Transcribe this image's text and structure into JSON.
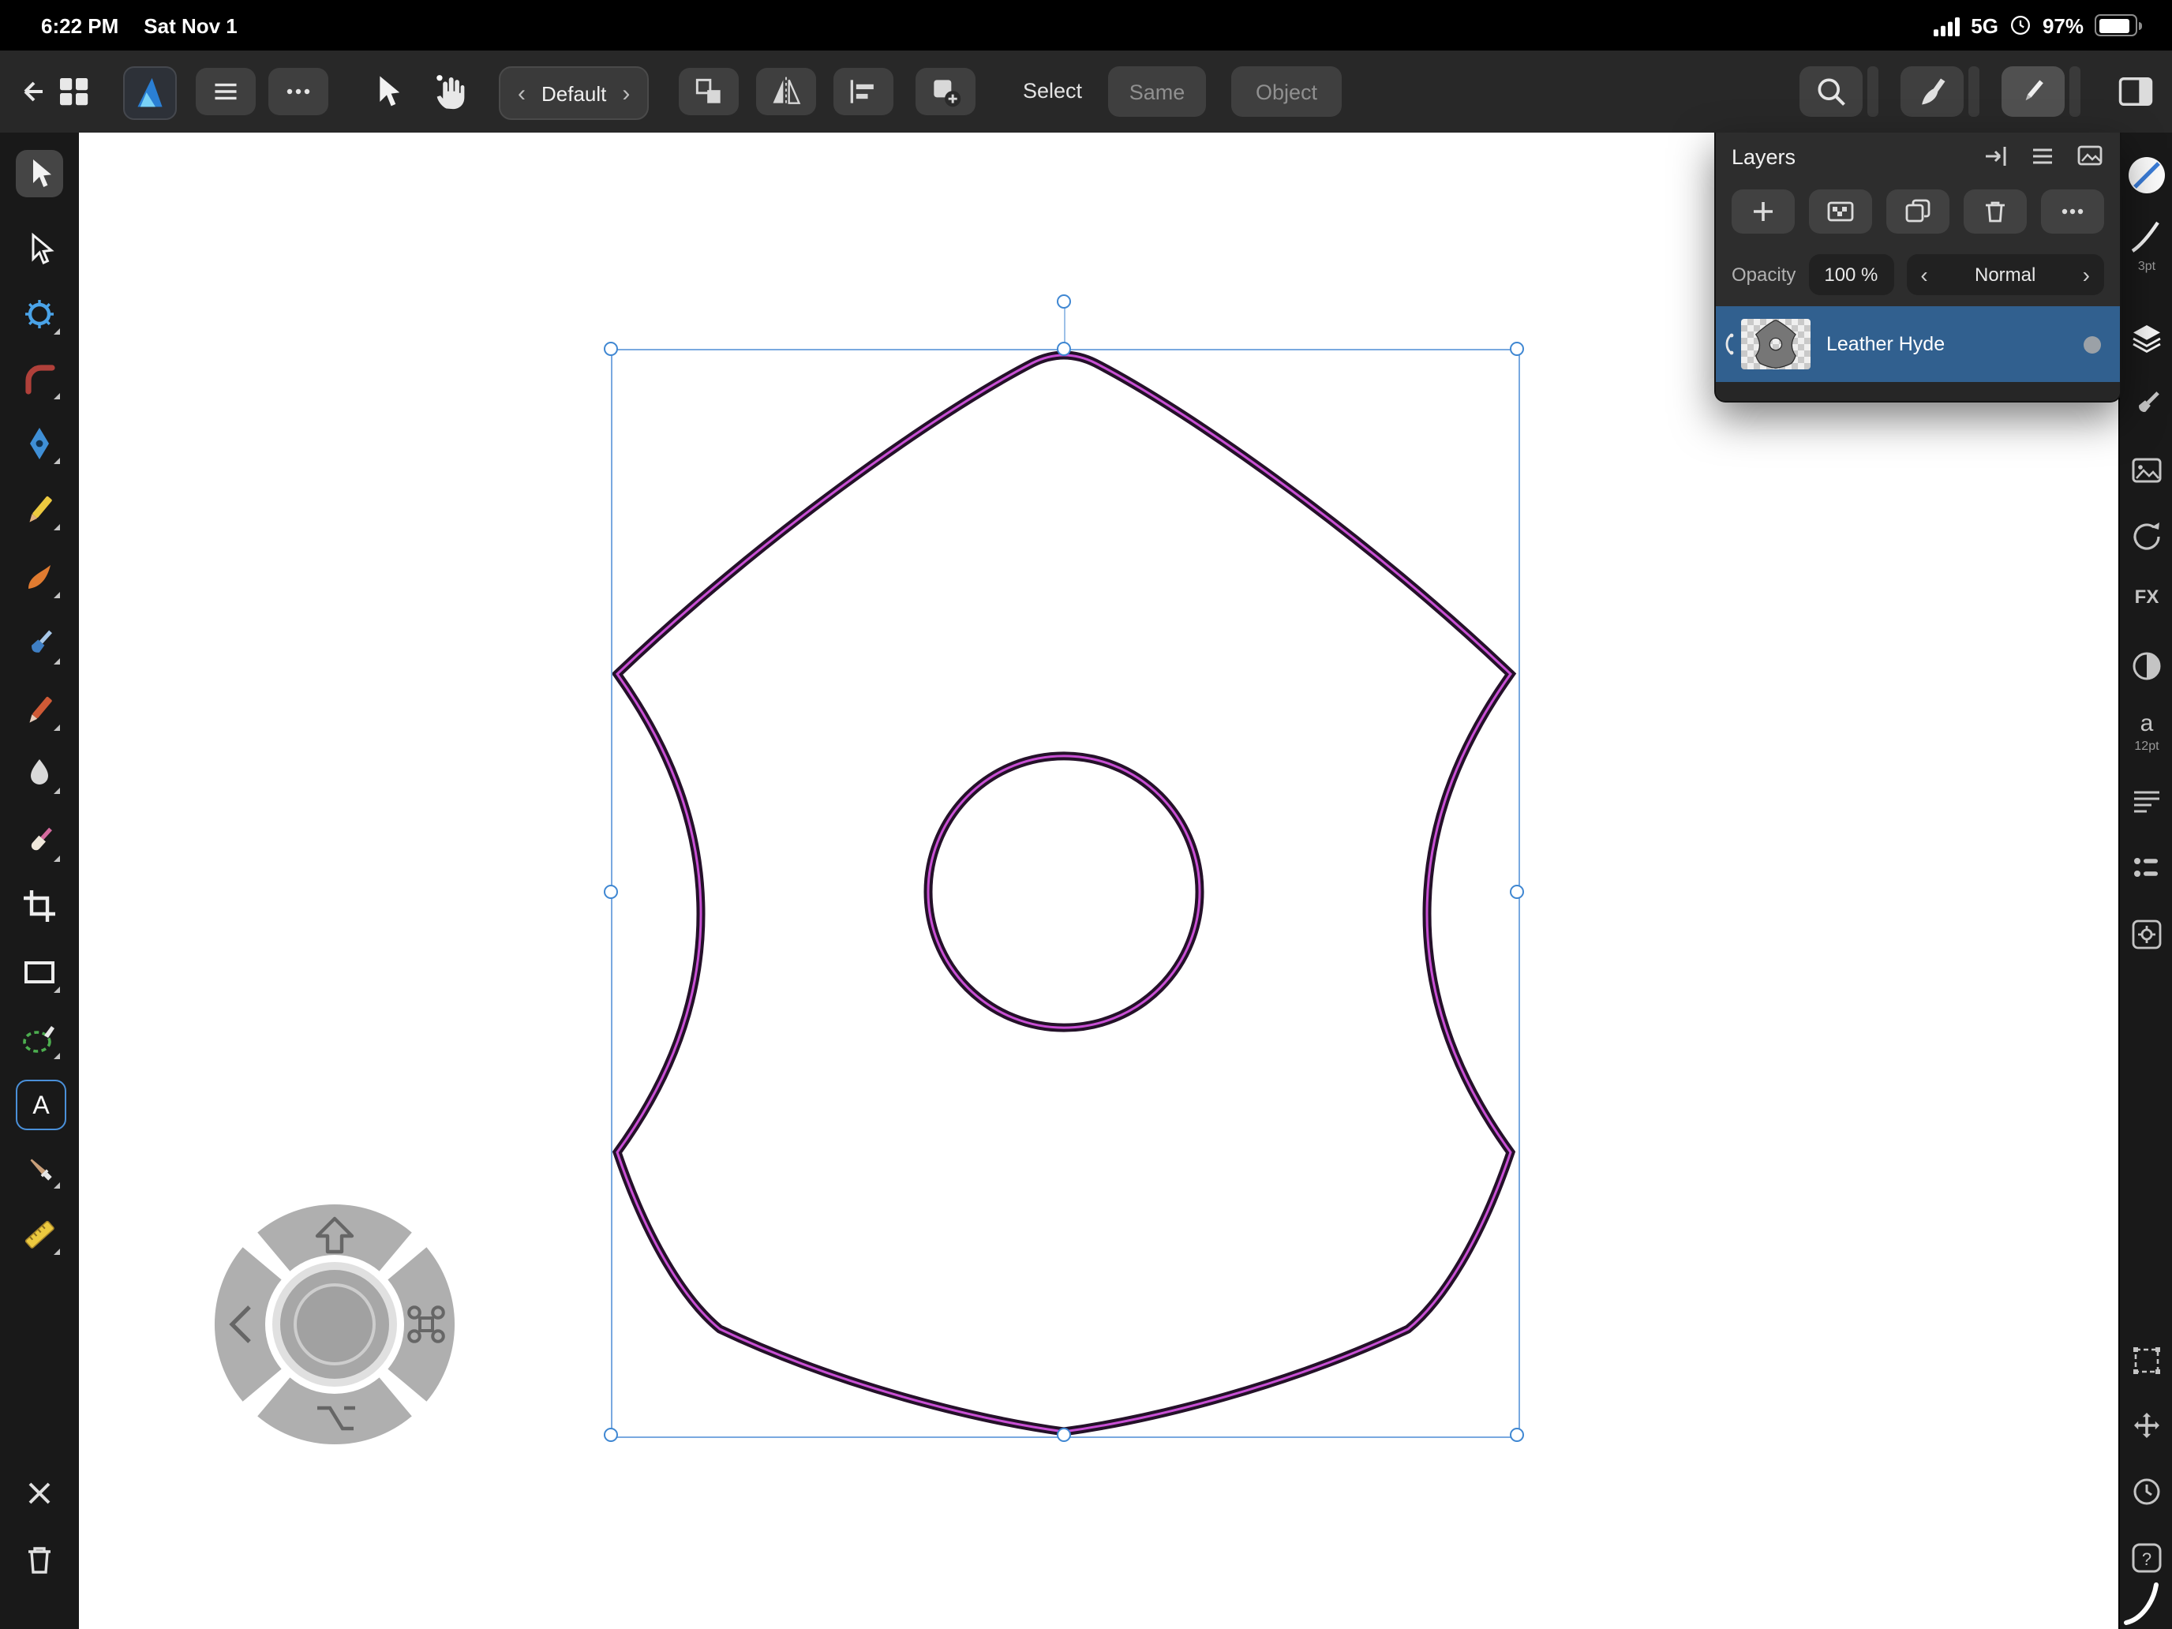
{
  "status_bar": {
    "time": "6:22 PM",
    "date": "Sat Nov 1",
    "network": "5G",
    "battery": "97%"
  },
  "toolbar": {
    "preset": "Default",
    "select_label": "Select",
    "same_button": "Same",
    "object_button": "Object"
  },
  "left_toolbar": {
    "text_tool_glyph": "A"
  },
  "layers_panel": {
    "title": "Layers",
    "opacity_label": "Opacity",
    "opacity_value": "100 %",
    "blend_mode": "Normal",
    "layers": [
      {
        "name": "Leather Hyde"
      }
    ]
  },
  "right_sidebar": {
    "stroke_width": "3pt",
    "fx_label": "FX",
    "text_glyph": "a",
    "font_size": "12pt",
    "help_glyph": "?"
  },
  "icons": {
    "chevron_left": "‹",
    "chevron_right": "›"
  }
}
